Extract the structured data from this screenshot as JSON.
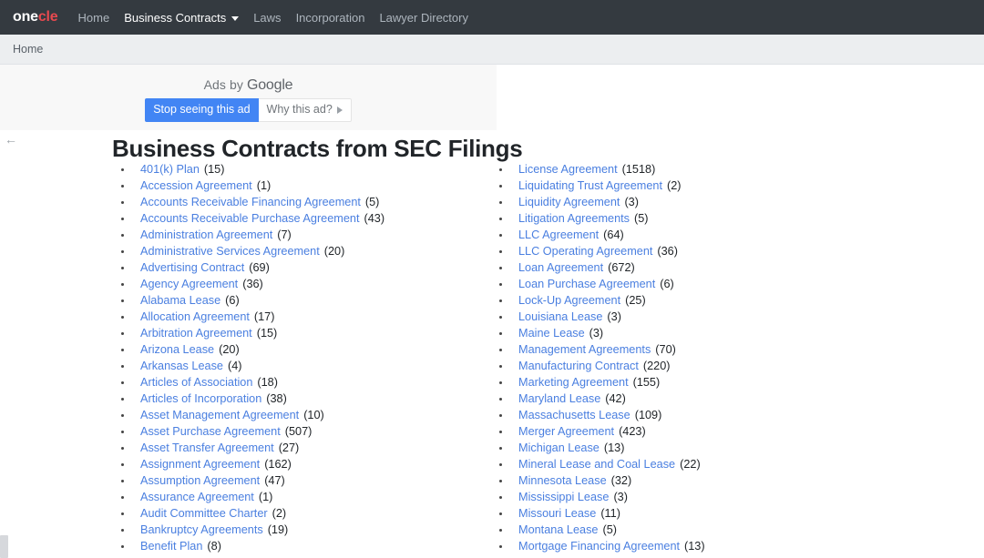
{
  "navbar": {
    "brand": {
      "part1": "one",
      "part2": "cle"
    },
    "links": [
      {
        "label": "Home",
        "active": false,
        "caret": false
      },
      {
        "label": "Business Contracts",
        "active": true,
        "caret": true
      },
      {
        "label": "Laws",
        "active": false,
        "caret": false
      },
      {
        "label": "Incorporation",
        "active": false,
        "caret": false
      },
      {
        "label": "Lawyer Directory",
        "active": false,
        "caret": false
      }
    ]
  },
  "breadcrumb": {
    "label": "Home"
  },
  "back_arrow": {
    "glyph": "←"
  },
  "ad": {
    "label_prefix": "Ads by ",
    "label_brand": "Google",
    "stop_button": "Stop seeing this ad",
    "why_button": "Why this ad?"
  },
  "page": {
    "title": "Business Contracts from SEC Filings"
  },
  "columns": [
    {
      "items": [
        {
          "name": "401(k) Plan",
          "count": "(15)"
        },
        {
          "name": "Accession Agreement",
          "count": "(1)"
        },
        {
          "name": "Accounts Receivable Financing Agreement",
          "count": "(5)"
        },
        {
          "name": "Accounts Receivable Purchase Agreement",
          "count": "(43)"
        },
        {
          "name": "Administration Agreement",
          "count": "(7)"
        },
        {
          "name": "Administrative Services Agreement",
          "count": "(20)"
        },
        {
          "name": "Advertising Contract",
          "count": "(69)"
        },
        {
          "name": "Agency Agreement",
          "count": "(36)"
        },
        {
          "name": "Alabama Lease",
          "count": "(6)"
        },
        {
          "name": "Allocation Agreement",
          "count": "(17)"
        },
        {
          "name": "Arbitration Agreement",
          "count": "(15)"
        },
        {
          "name": "Arizona Lease",
          "count": "(20)"
        },
        {
          "name": "Arkansas Lease",
          "count": "(4)"
        },
        {
          "name": "Articles of Association",
          "count": "(18)"
        },
        {
          "name": "Articles of Incorporation",
          "count": "(38)"
        },
        {
          "name": "Asset Management Agreement",
          "count": "(10)"
        },
        {
          "name": "Asset Purchase Agreement",
          "count": "(507)"
        },
        {
          "name": "Asset Transfer Agreement",
          "count": "(27)"
        },
        {
          "name": "Assignment Agreement",
          "count": "(162)"
        },
        {
          "name": "Assumption Agreement",
          "count": "(47)"
        },
        {
          "name": "Assurance Agreement",
          "count": "(1)"
        },
        {
          "name": "Audit Committee Charter",
          "count": "(2)"
        },
        {
          "name": "Bankruptcy Agreements",
          "count": "(19)"
        },
        {
          "name": "Benefit Plan",
          "count": "(8)"
        }
      ]
    },
    {
      "items": [
        {
          "name": "License Agreement",
          "count": "(1518)"
        },
        {
          "name": "Liquidating Trust Agreement",
          "count": "(2)"
        },
        {
          "name": "Liquidity Agreement",
          "count": "(3)"
        },
        {
          "name": "Litigation Agreements",
          "count": "(5)"
        },
        {
          "name": "LLC Agreement",
          "count": "(64)"
        },
        {
          "name": "LLC Operating Agreement",
          "count": "(36)"
        },
        {
          "name": "Loan Agreement",
          "count": "(672)"
        },
        {
          "name": "Loan Purchase Agreement",
          "count": "(6)"
        },
        {
          "name": "Lock-Up Agreement",
          "count": "(25)"
        },
        {
          "name": "Louisiana Lease",
          "count": "(3)"
        },
        {
          "name": "Maine Lease",
          "count": "(3)"
        },
        {
          "name": "Management Agreements",
          "count": "(70)"
        },
        {
          "name": "Manufacturing Contract",
          "count": "(220)"
        },
        {
          "name": "Marketing Agreement",
          "count": "(155)"
        },
        {
          "name": "Maryland Lease",
          "count": "(42)"
        },
        {
          "name": "Massachusetts Lease",
          "count": "(109)"
        },
        {
          "name": "Merger Agreement",
          "count": "(423)"
        },
        {
          "name": "Michigan Lease",
          "count": "(13)"
        },
        {
          "name": "Mineral Lease and Coal Lease",
          "count": "(22)"
        },
        {
          "name": "Minnesota Lease",
          "count": "(32)"
        },
        {
          "name": "Mississippi Lease",
          "count": "(3)"
        },
        {
          "name": "Missouri Lease",
          "count": "(11)"
        },
        {
          "name": "Montana Lease",
          "count": "(5)"
        },
        {
          "name": "Mortgage Financing Agreement",
          "count": "(13)"
        }
      ]
    }
  ],
  "colors": {
    "navbar_bg": "#343a40",
    "brand_accent": "#e8494f",
    "breadcrumb_bg": "#eceef0",
    "link": "#4a7fe0",
    "ad_button": "#4285f4"
  }
}
